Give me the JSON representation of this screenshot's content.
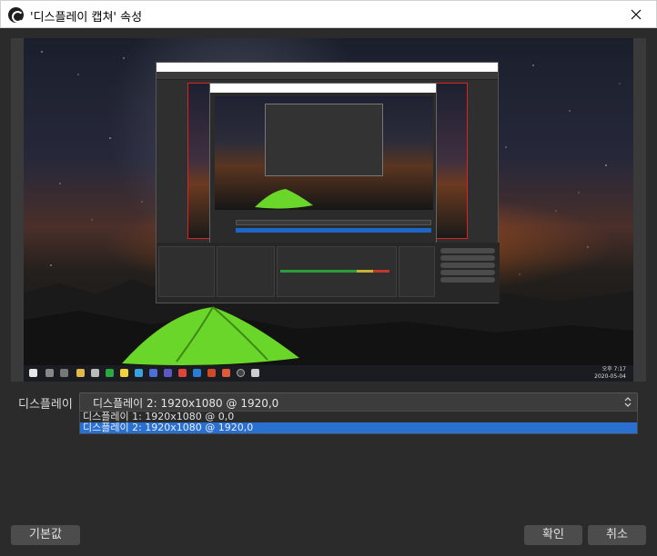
{
  "window": {
    "title": "'디스플레이 캡쳐' 속성",
    "icon": "obs-icon",
    "close_icon": "close-icon"
  },
  "preview": {
    "taskbar_clock": [
      "오후 7:17",
      "2020-05-04"
    ]
  },
  "display": {
    "label": "디스플레이",
    "selected": "디스플레이 2: 1920x1080 @ 1920,0",
    "options": [
      "디스플레이 1: 1920x1080 @ 0,0",
      "디스플레이 2: 1920x1080 @ 1920,0"
    ],
    "highlighted_option_index": 1
  },
  "buttons": {
    "defaults": "기본값",
    "ok": "확인",
    "cancel": "취소"
  },
  "colors": {
    "dialog_bg": "#2b2b2b",
    "highlight": "#2a70d0",
    "button_bg": "#4c4c4c"
  }
}
